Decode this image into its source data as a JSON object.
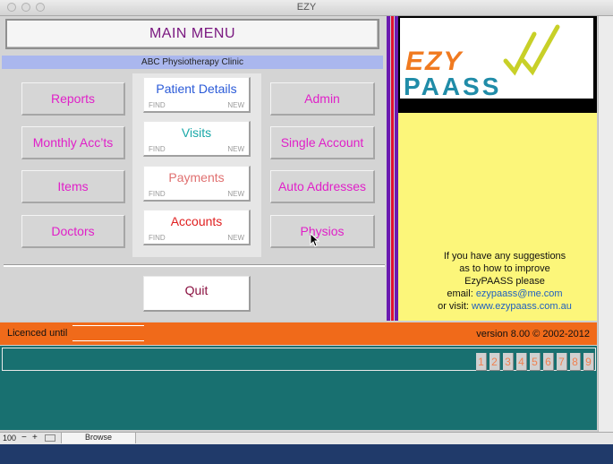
{
  "window": {
    "title": "EZY"
  },
  "header": {
    "main_menu": "MAIN  MENU",
    "clinic": "ABC Physiotherapy Clinic"
  },
  "left_buttons": [
    {
      "label": "Reports"
    },
    {
      "label": "Monthly Acc’ts"
    },
    {
      "label": "Items"
    },
    {
      "label": "Doctors"
    }
  ],
  "center_buttons": [
    {
      "label": "Patient Details",
      "color": "#2a5ad8",
      "find": "FIND",
      "new": "NEW"
    },
    {
      "label": "Visits",
      "color": "#18a8a8",
      "find": "FIND",
      "new": "NEW"
    },
    {
      "label": "Payments",
      "color": "#e07070",
      "find": "FIND",
      "new": "NEW"
    },
    {
      "label": "Accounts",
      "color": "#e02020",
      "find": "FIND",
      "new": "NEW"
    }
  ],
  "right_buttons": [
    {
      "label": "Admin"
    },
    {
      "label": "Single Account"
    },
    {
      "label": "Auto Addresses"
    },
    {
      "label": "Physios"
    }
  ],
  "quit": {
    "label": "Quit"
  },
  "logo": {
    "top": "EZY",
    "bottom": "PAASS"
  },
  "suggestion": {
    "line1": "If you have any suggestions",
    "line2": "as to how to improve",
    "line3": "EzyPAASS please",
    "email_label": "email:",
    "email": "ezypaass@me.com",
    "visit_label": "or visit:",
    "website": "www.ezypaass.com.au"
  },
  "license": {
    "label": "Licenced until",
    "value": ""
  },
  "version": "version 8.00 © 2002-2012",
  "pages": [
    "1",
    "2",
    "3",
    "4",
    "5",
    "6",
    "7",
    "8",
    "9"
  ],
  "statusbar": {
    "zoom": "100",
    "mode": "Browse"
  },
  "colors": {
    "orange": "#f06a1a",
    "teal": "#187070",
    "yellow": "#fcf67a",
    "pink": "#e020c8"
  }
}
